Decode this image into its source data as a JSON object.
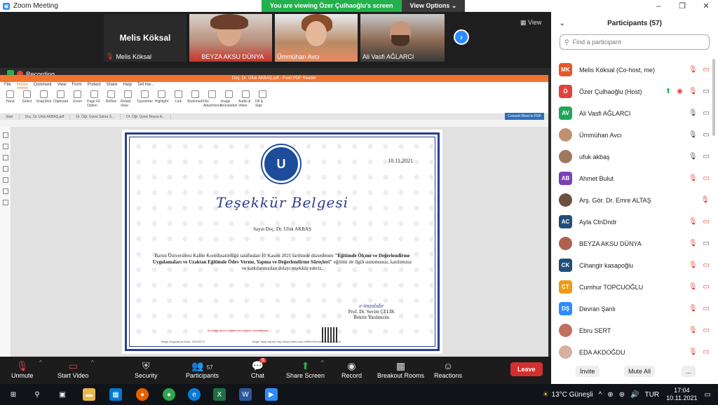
{
  "window": {
    "title": "Zoom Meeting",
    "controls": [
      "–",
      "❐",
      "✕"
    ]
  },
  "share_banner": {
    "viewing": "You are viewing Özer Çulhaoğlu's screen",
    "options": "View Options"
  },
  "strip": {
    "tiles": [
      {
        "big": "Melis Köksal",
        "name": "Melis Köksal",
        "muted": true
      },
      {
        "name": "BEYZA AKSU DÜNYA",
        "muted": true
      },
      {
        "name": "Ümmühan Avcı",
        "muted": false
      },
      {
        "name": "Ali Vasfi AĞLARCI",
        "muted": false
      }
    ],
    "view_label": "View"
  },
  "recording_label": "Recording",
  "pdf": {
    "titlebar": "Doç. Dr. Ufuk AKBAŞ.pdf - Foxit PDF Reader",
    "menu": [
      "File",
      "Home",
      "Comment",
      "View",
      "Form",
      "Protect",
      "Share",
      "Help",
      "Tell me..."
    ],
    "ribbon": [
      "Hand",
      "Select",
      "SnapShot",
      "Clipboard",
      "Zoom",
      "Page Fit Option",
      "Reflow",
      "Rotate View",
      "Typewriter",
      "Highlight",
      "Link",
      "Bookmark",
      "File Attachment",
      "Image Annotation",
      "Audio & Video",
      "Fill & Sign"
    ],
    "convert": "Convert Word to PDF",
    "tabs": [
      "Start",
      "Doç. Dr. Ufuk AKBAŞ.pdf",
      "Dr. Öğr. Üyesi Sahra S...",
      "Dr. Öğr. Üyesi Beyza A..."
    ]
  },
  "certificate": {
    "date": "10.11.2021",
    "title": "Teşekkür Belgesi",
    "recipient": "Sayın Doç. Dr. Ufuk AKBAŞ",
    "body_plain": "Bartın Üniversitesi Kalite Koordinatörlüğü tarafından 10 Kasım 2021 tarihinde düzenlenen",
    "body_bold": "\"Eğitimde Ölçme ve Değerlendirme Uygulamaları ve Uzaktan Eğitimde Ödev Verme, Yapma ve Değerlendirme Süreçleri\"",
    "body_tail": "eğitimi ile ilgili sunumunuz, katılımınız ve katkılarınızdan dolayı teşekkür ederiz.",
    "sign_script": "e-imzalıdır",
    "signer": "Prof. Dr. Sevim ÇELİK",
    "signer_title": "Rektör Yardımcısı",
    "red_note": "Bu belge güvenli elektronik imza ile imzalanmıştır.",
    "foot_left": "Belge Doğrulama Kodu: 3VPJ0E72",
    "foot_right": "Belge Takip Adresi: http://ebys.bartin.edu.tr/BEKO/Kontrol/Dogrula/ürün"
  },
  "toolbar": {
    "unmute": "Unmute",
    "start_video": "Start Video",
    "security": "Security",
    "participants": "Participants",
    "participants_count": "57",
    "chat": "Chat",
    "chat_badge": "5",
    "share_screen": "Share Screen",
    "record": "Record",
    "breakout": "Breakout Rooms",
    "reactions": "Reactions",
    "leave": "Leave"
  },
  "participants": {
    "header": "Participants (57)",
    "search_placeholder": "Find a participant",
    "list": [
      {
        "initials": "MK",
        "color": "#e4582a",
        "name": "Melis Köksal (Co-host, me)",
        "icons": [
          "mic-off",
          "video-off"
        ]
      },
      {
        "initials": "Ö",
        "color": "#e0433a",
        "name": "Özer Çulhaoğlu (Host)",
        "icons": [
          "share",
          "rec",
          "mic-off",
          "video-on"
        ]
      },
      {
        "initials": "AV",
        "color": "#23a45a",
        "name": "Ali Vasfi AĞLARCI",
        "icons": [
          "mic-on",
          "video-on"
        ]
      },
      {
        "initials": "",
        "color": "#c09070",
        "name": "Ümmühan Avcı",
        "icons": [
          "mic-on",
          "video-on"
        ]
      },
      {
        "initials": "",
        "color": "#a07860",
        "name": "ufuk akbaş",
        "icons": [
          "mic-on",
          "video-on"
        ]
      },
      {
        "initials": "AB",
        "color": "#7b3fb4",
        "name": "Ahmet Bulut",
        "icons": [
          "mic-off",
          "video-off"
        ]
      },
      {
        "initials": "",
        "color": "#6a5040",
        "name": "Arş. Gör. Dr. Emre ALTAŞ",
        "icons": [
          "mic-off"
        ]
      },
      {
        "initials": "AC",
        "color": "#1f4f7a",
        "name": "Ayla CtnDndr",
        "icons": [
          "mic-off",
          "video-off"
        ]
      },
      {
        "initials": "",
        "color": "#b06050",
        "name": "BEYZA AKSU DÜNYA",
        "icons": [
          "mic-off",
          "video-on"
        ]
      },
      {
        "initials": "CK",
        "color": "#1f4f7a",
        "name": "Cihangir kasapoğlu",
        "icons": [
          "mic-off",
          "video-off"
        ]
      },
      {
        "initials": "CT",
        "color": "#ee9b1a",
        "name": "Cumhur TOPCUOĞLU",
        "icons": [
          "mic-off",
          "video-off"
        ]
      },
      {
        "initials": "DŞ",
        "color": "#2d8cff",
        "name": "Devran Şanlı",
        "icons": [
          "mic-off",
          "video-off"
        ]
      },
      {
        "initials": "",
        "color": "#c07060",
        "name": "Ebru SERT",
        "icons": [
          "mic-off",
          "video-off"
        ]
      },
      {
        "initials": "",
        "color": "#d8b0a0",
        "name": "EDA AKDOĞDU",
        "icons": [
          "mic-off",
          "video-off"
        ]
      }
    ],
    "invite": "Invite",
    "mute_all": "Mute All",
    "more": "..."
  },
  "taskbar": {
    "weather": "13°C Güneşli",
    "time": "17:04",
    "date": "10.11.2021"
  }
}
